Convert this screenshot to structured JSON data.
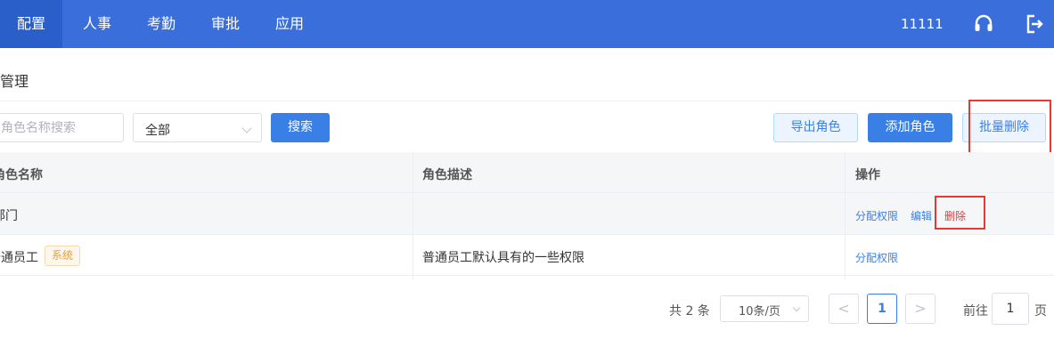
{
  "nav": {
    "tabs": [
      {
        "label": "配置",
        "active": true
      },
      {
        "label": "人事"
      },
      {
        "label": "考勤"
      },
      {
        "label": "审批"
      },
      {
        "label": "应用"
      }
    ],
    "user": "11111",
    "icons": {
      "support": "headset-icon",
      "logout": "logout-icon"
    }
  },
  "page": {
    "title": "管理"
  },
  "toolbar": {
    "search_placeholder": "角色名称搜索",
    "filter_value": "全部",
    "search_label": "搜索",
    "export_label": "导出角色",
    "add_label": "添加角色",
    "batch_delete_label": "批量删除"
  },
  "table": {
    "columns": [
      "角色名称",
      "角色描述",
      "操作"
    ],
    "rows": [
      {
        "name": "部门",
        "tag": "",
        "desc": "",
        "actions": [
          "分配权限",
          "编辑",
          "删除"
        ]
      },
      {
        "name": "普通员工",
        "tag": "系统",
        "desc": "普通员工默认具有的一些权限",
        "actions": [
          "分配权限"
        ]
      }
    ]
  },
  "pagination": {
    "total": "共 2 条",
    "page_size": "10条/页",
    "prev": "<",
    "current": "1",
    "next": ">",
    "goto_prefix": "前往",
    "goto_value": "1",
    "goto_suffix": "页"
  },
  "colors": {
    "brand": "#3a6fdb",
    "primary": "#3a7fe6",
    "danger": "#e53935",
    "highlight_box": "#e53935"
  }
}
